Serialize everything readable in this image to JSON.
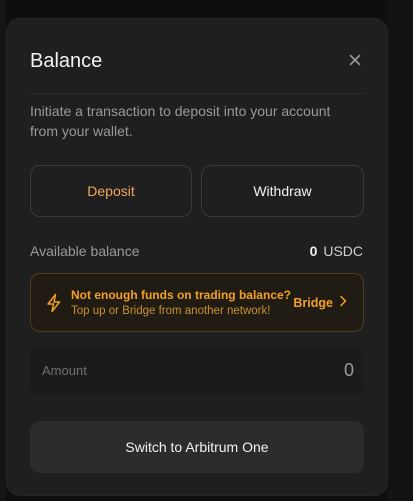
{
  "modal": {
    "title": "Balance",
    "description": "Initiate a transaction to deposit into your account from your wallet."
  },
  "tabs": [
    {
      "label": "Deposit",
      "active": true
    },
    {
      "label": "Withdraw",
      "active": false
    }
  ],
  "balance": {
    "label": "Available balance",
    "value": "0",
    "unit": "USDC"
  },
  "notice": {
    "title": "Not enough funds on trading balance?",
    "subtitle": "Top up or Bridge from another network!",
    "action_label": "Bridge"
  },
  "amount": {
    "label": "Amount",
    "value": "0"
  },
  "cta": {
    "label": "Switch to Arbitrum One"
  },
  "colors": {
    "accent": "#f2a024",
    "deposit_active": "#f2a65a",
    "panel": "#1f1f1f"
  },
  "icons": {
    "close": "close-icon",
    "notice": "lightning-icon",
    "bridge_arrow": "chevron-right-icon"
  }
}
